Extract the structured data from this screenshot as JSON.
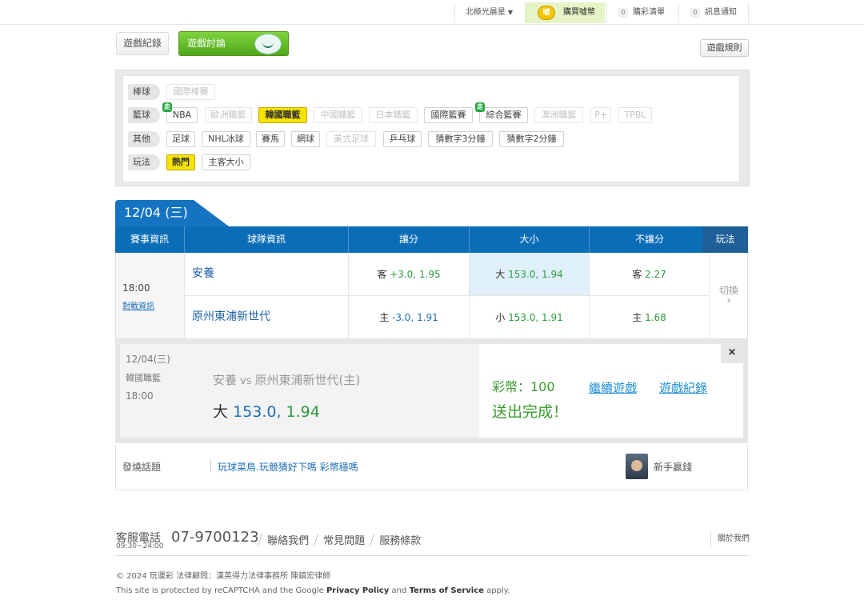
{
  "topbar": {
    "star_label": "北極光晨星",
    "buy_coin_label": "購買噓幣",
    "coin_badge": "噓",
    "cart_count": "0",
    "cart_label": "購彩清單",
    "msg_count": "0",
    "msg_label": "訊息通知"
  },
  "tabs": {
    "record": "遊戲紀錄",
    "discuss": "遊戲討論",
    "rules": "遊戲規則"
  },
  "filters": {
    "baseball": {
      "head": "棒球",
      "chips": [
        "國際棒賽"
      ]
    },
    "basketball": {
      "head": "籃球",
      "chips": [
        "NBA",
        "歐洲職籃",
        "韓國職籃",
        "中國職籃",
        "日本職籃",
        "國際籃賽",
        "綜合籃賽",
        "澳洲職籃",
        "P+",
        "TPBL"
      ],
      "go_badge": "走"
    },
    "other": {
      "head": "其他",
      "chips": [
        "足球",
        "NHL冰球",
        "賽馬",
        "網球",
        "美式足球",
        "乒乓球",
        "猜數字3分鐘",
        "猜數字2分鐘"
      ]
    },
    "play": {
      "head": "玩法",
      "chips": [
        "熱門",
        "主客大小"
      ]
    }
  },
  "date_tab": "12/04 (三)",
  "table": {
    "headers": {
      "info": "賽事資訊",
      "team": "球隊資訊",
      "handicap": "讓分",
      "total": "大小",
      "moneyline": "不讓分",
      "play": "玩法"
    },
    "time": "18:00",
    "vs_link": "對戰資訊",
    "switch": "切換",
    "switch_arrow": "›",
    "rows": [
      {
        "team": "安養",
        "hc_side": "客",
        "hc_val": "+3.0, 1.95",
        "tot_side": "大",
        "tot_val": "153.0, 1.94",
        "ml_side": "客",
        "ml_val": "2.27"
      },
      {
        "team": "原州東浦新世代",
        "hc_side": "主",
        "hc_val": "-3.0, 1.91",
        "tot_side": "小",
        "tot_val": "153.0, 1.91",
        "ml_side": "主",
        "ml_val": "1.68"
      }
    ]
  },
  "confirm": {
    "date": "12/04(三)",
    "league": "韓國職籃",
    "time": "18:00",
    "away": "安養",
    "vs": "vs",
    "home": "原州東浦新世代(主)",
    "pick_side": "大",
    "pick_val": "153.0,",
    "pick_odds": "1.94",
    "coin_text": "彩幣：100",
    "done_text": "送出完成！",
    "continue_link": "繼續遊戲",
    "record_link": "遊戲紀錄",
    "close": "×"
  },
  "hot": {
    "label": "發燒話題",
    "link": "玩球菜鳥.玩競猜好下嗎 彩幣穩嗎",
    "user": "新手贏錢"
  },
  "footer": {
    "hotline": "客服電話",
    "hours": "09:30~24:00",
    "phone": "07-9700123",
    "links": [
      "聯絡我們",
      "常見問題",
      "服務條款"
    ],
    "about": "關於我們",
    "copyright": "© 2024 玩運彩 法律顧問：漢英得力法律事務所 陳鎮宏律師",
    "captcha_pre": "This site is protected by reCAPTCHA and the Google",
    "privacy": "Privacy Policy",
    "and": "and",
    "terms": "Terms of Service",
    "apply": "apply."
  },
  "colors": {
    "blue": "#0c6db7",
    "green": "#3a9b2e",
    "yellow": "#f7e300"
  }
}
